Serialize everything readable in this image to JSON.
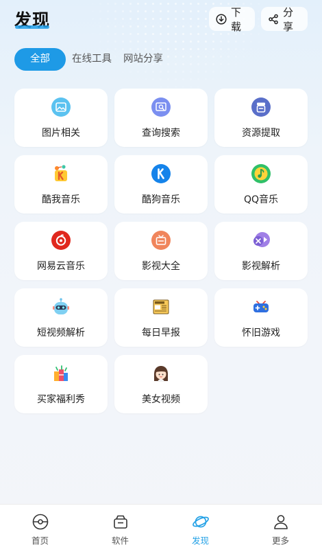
{
  "header": {
    "title": "发现",
    "download_label": "下载",
    "share_label": "分享"
  },
  "tabs": [
    {
      "label": "全部",
      "active": true
    },
    {
      "label": "在线工具",
      "active": false
    },
    {
      "label": "网站分享",
      "active": false
    }
  ],
  "cards": [
    {
      "label": "图片相关",
      "icon": "image-icon"
    },
    {
      "label": "查询搜索",
      "icon": "search-card-icon"
    },
    {
      "label": "资源提取",
      "icon": "extract-icon"
    },
    {
      "label": "酷我音乐",
      "icon": "kuwo-music-icon"
    },
    {
      "label": "酷狗音乐",
      "icon": "kugou-music-icon"
    },
    {
      "label": "QQ音乐",
      "icon": "qq-music-icon"
    },
    {
      "label": "网易云音乐",
      "icon": "netease-music-icon"
    },
    {
      "label": "影视大全",
      "icon": "tv-icon"
    },
    {
      "label": "影视解析",
      "icon": "video-parse-icon"
    },
    {
      "label": "短视频解析",
      "icon": "robot-icon"
    },
    {
      "label": "每日早报",
      "icon": "newspaper-icon"
    },
    {
      "label": "怀旧游戏",
      "icon": "gamepad-icon"
    },
    {
      "label": "买家福利秀",
      "icon": "gift-icon"
    },
    {
      "label": "美女视频",
      "icon": "girl-icon"
    }
  ],
  "tabbar": [
    {
      "label": "首页",
      "icon": "home-icon",
      "active": false
    },
    {
      "label": "软件",
      "icon": "software-icon",
      "active": false
    },
    {
      "label": "发现",
      "icon": "discover-planet-icon",
      "active": true
    },
    {
      "label": "更多",
      "icon": "profile-icon",
      "active": false
    }
  ],
  "colors": {
    "accent": "#1e9ae6",
    "active_tab_text": "#23a1e6",
    "card_bg": "#ffffff"
  }
}
